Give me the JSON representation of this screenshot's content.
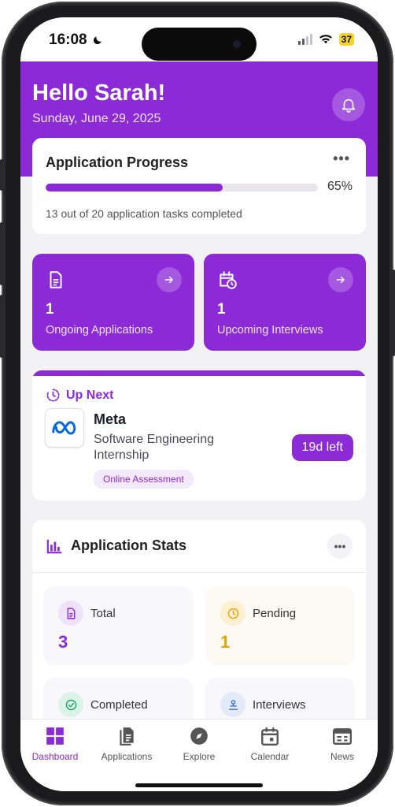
{
  "status_bar": {
    "time": "16:08",
    "battery": "37"
  },
  "header": {
    "greeting": "Hello Sarah!",
    "date": "Sunday, June 29, 2025"
  },
  "progress": {
    "title": "Application Progress",
    "percent_label": "65%",
    "percent": 65,
    "subtitle": "13 out of 20 application tasks completed"
  },
  "tiles": [
    {
      "count": "1",
      "label": "Ongoing Applications",
      "icon": "document-icon"
    },
    {
      "count": "1",
      "label": "Upcoming Interviews",
      "icon": "calendar-clock-icon"
    }
  ],
  "up_next": {
    "heading": "Up Next",
    "company": "Meta",
    "role": "Software Engineering Internship",
    "tag": "Online Assessment",
    "days_left": "19d left"
  },
  "stats": {
    "title": "Application Stats",
    "items": [
      {
        "label": "Total",
        "value": "3",
        "color": "#8c2ad8",
        "icon": "document-icon"
      },
      {
        "label": "Pending",
        "value": "1",
        "color": "#e5a50a",
        "icon": "clock-icon"
      },
      {
        "label": "Completed",
        "value": "",
        "color": "#1aa56b",
        "icon": "check-circle-icon"
      },
      {
        "label": "Interviews",
        "value": "",
        "color": "#3b6fd6",
        "icon": "interview-icon"
      }
    ]
  },
  "nav": [
    {
      "label": "Dashboard",
      "active": true
    },
    {
      "label": "Applications",
      "active": false
    },
    {
      "label": "Explore",
      "active": false
    },
    {
      "label": "Calendar",
      "active": false
    },
    {
      "label": "News",
      "active": false
    }
  ],
  "colors": {
    "brand": "#8c2ad8",
    "background": "#f2f2f5"
  }
}
